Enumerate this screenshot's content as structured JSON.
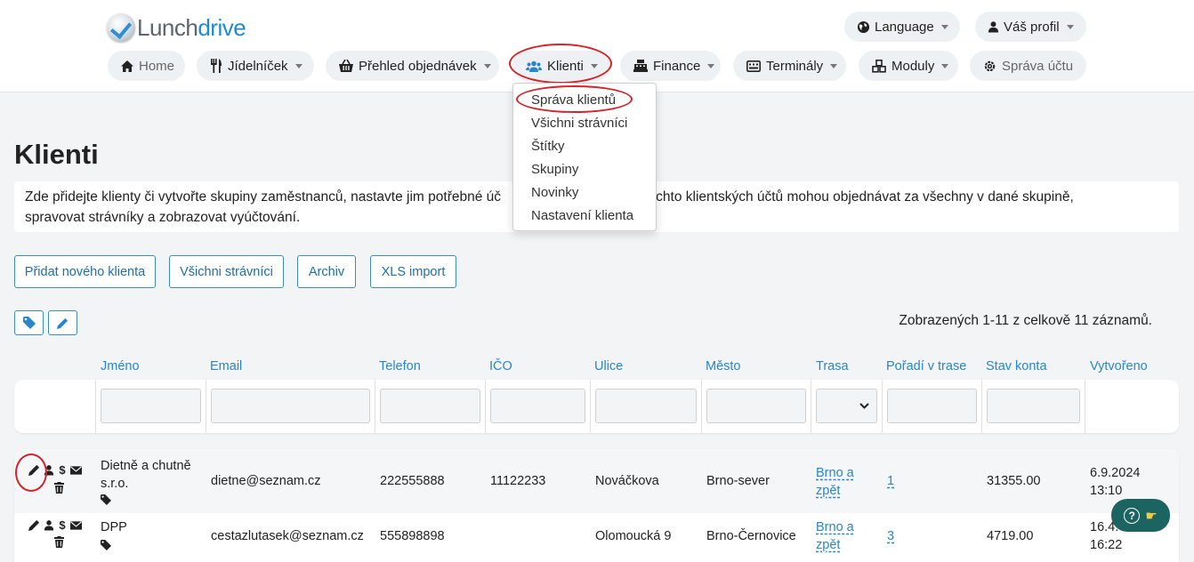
{
  "app": {
    "logo_a": "Lunch",
    "logo_b": "drive"
  },
  "top": {
    "language": "Language",
    "profile": "Váš profil"
  },
  "nav": [
    {
      "label": "Home",
      "icon": "home-icon"
    },
    {
      "label": "Jídelníček",
      "icon": "utensils-icon"
    },
    {
      "label": "Přehled objednávek",
      "icon": "basket-icon"
    },
    {
      "label": "Klienti",
      "icon": "users-icon"
    },
    {
      "label": "Finance",
      "icon": "cash-register-icon"
    },
    {
      "label": "Terminály",
      "icon": "terminal-icon"
    },
    {
      "label": "Moduly",
      "icon": "cubes-icon"
    },
    {
      "label": "Správa účtu",
      "icon": "gear-icon"
    }
  ],
  "dropdown": [
    "Správa klientů",
    "Všichni strávníci",
    "Štítky",
    "Skupiny",
    "Novinky",
    "Nastavení klienta"
  ],
  "page": {
    "title": "Klienti",
    "info_line1": "Zde přidejte klienty či vytvořte skupiny zaměstnanců, nastavte jim potřebné úč",
    "info_line1b": "e. Správci těchto klientských účtů mohou objednávat za všechny v dané skupině,",
    "info_line2": "spravovat strávníky a zobrazovat vyúčtování."
  },
  "buttons": {
    "add_client": "Přidat nového klienta",
    "all_diners": "Všichni strávníci",
    "archive": "Archiv",
    "xls_import": "XLS import"
  },
  "records_info": "Zobrazených 1-11 z celkově 11 záznamů.",
  "columns": [
    "Jméno",
    "Email",
    "Telefon",
    "IČO",
    "Ulice",
    "Město",
    "Trasa",
    "Pořadí v trase",
    "Stav konta",
    "Vytvořeno"
  ],
  "rows": [
    {
      "name1": "Dietně a chutně",
      "name2": "s.r.o.",
      "email": "dietne@seznam.cz",
      "phone": "222555888",
      "ico": "11122233",
      "street": "Nováčkova",
      "city": "Brno-sever",
      "route1": "Brno a",
      "route2": "zpět",
      "order": "1",
      "balance": "31355.00",
      "created1": "6.9.2024",
      "created2": "13:10"
    },
    {
      "name1": "DPP",
      "name2": "",
      "email": "cestazlutasek@seznam.cz",
      "phone": "555898898",
      "ico": "",
      "street": "Olomoucká 9",
      "city": "Brno-Černovice",
      "route1": "Brno a",
      "route2": "zpět",
      "order": "3",
      "balance": "4719.00",
      "created1": "16.4.",
      "created2": "16:22"
    }
  ],
  "colors": {
    "accent": "#2a87c7",
    "annotation": "#d6222b",
    "help": "#1c6461"
  }
}
